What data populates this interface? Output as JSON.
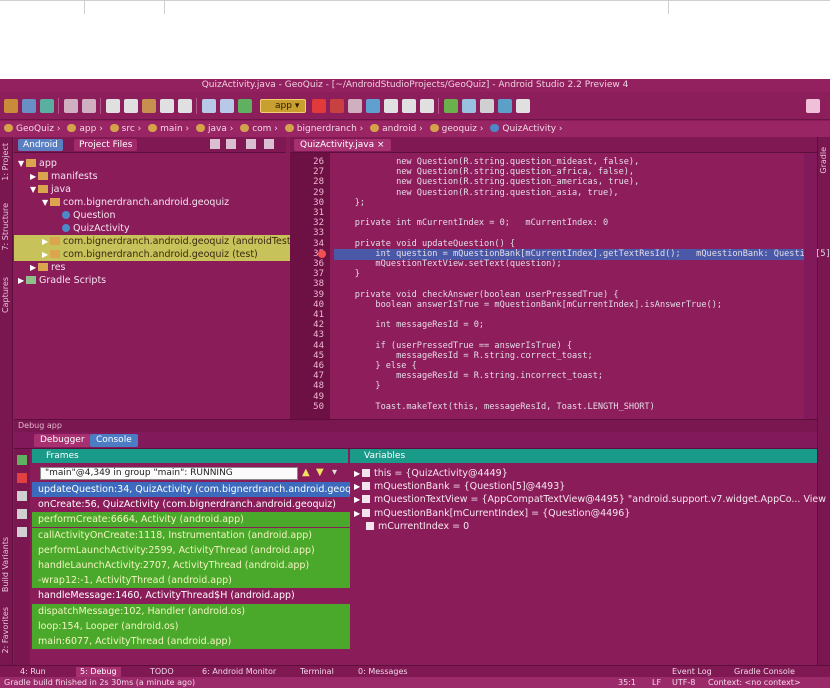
{
  "window": {
    "title": "QuizActivity.java - GeoQuiz - [~/AndroidStudioProjects/GeoQuiz] - Android Studio 2.2 Preview 4"
  },
  "toolbar": {
    "run_config": "app",
    "icons": [
      "open-icon",
      "save-icon",
      "sync-icon",
      "undo-icon",
      "redo-icon",
      "cut-icon",
      "copy-icon",
      "paste-icon",
      "find-icon",
      "replace-icon",
      "back-icon",
      "forward-icon",
      "build-icon",
      "run-config-dropdown",
      "run-icon",
      "debug-icon",
      "profile-icon",
      "avd-icon",
      "sdk-icon",
      "help-icon",
      "search-icon"
    ]
  },
  "breadcrumbs": [
    "GeoQuiz",
    "app",
    "src",
    "main",
    "java",
    "com",
    "bignerdranch",
    "android",
    "geoquiz",
    "QuizActivity"
  ],
  "left_strip": {
    "project": "1: Project",
    "structure": "7: Structure",
    "captures": "Captures",
    "variants": "Build Variants",
    "favorites": "2: Favorites"
  },
  "right_strip": {
    "gradle": "Gradle"
  },
  "project_pane": {
    "tabs": [
      "Android",
      "Project Files"
    ],
    "tree": [
      {
        "label": "app",
        "depth": 0,
        "expanded": true,
        "icon": "folder"
      },
      {
        "label": "manifests",
        "depth": 1,
        "expanded": false,
        "icon": "folder"
      },
      {
        "label": "java",
        "depth": 1,
        "expanded": true,
        "icon": "folder"
      },
      {
        "label": "com.bignerdranch.android.geoquiz",
        "depth": 2,
        "expanded": true,
        "icon": "package"
      },
      {
        "label": "Question",
        "depth": 3,
        "icon": "class"
      },
      {
        "label": "QuizActivity",
        "depth": 3,
        "icon": "class"
      },
      {
        "label": "com.bignerdranch.android.geoquiz (androidTest)",
        "depth": 2,
        "expanded": false,
        "icon": "package",
        "selected": true
      },
      {
        "label": "com.bignerdranch.android.geoquiz (test)",
        "depth": 2,
        "expanded": false,
        "icon": "package",
        "selected": true
      },
      {
        "label": "res",
        "depth": 1,
        "expanded": false,
        "icon": "folder"
      },
      {
        "label": "Gradle Scripts",
        "depth": 0,
        "expanded": false,
        "icon": "gradle"
      }
    ]
  },
  "editor": {
    "tab": "QuizActivity.java",
    "lines": [
      {
        "n": 26,
        "text": "            new Question(R.string.question_mideast, false),"
      },
      {
        "n": 27,
        "text": "            new Question(R.string.question_africa, false),"
      },
      {
        "n": 28,
        "text": "            new Question(R.string.question_americas, true),"
      },
      {
        "n": 29,
        "text": "            new Question(R.string.question_asia, true),"
      },
      {
        "n": 30,
        "text": "    };"
      },
      {
        "n": 31,
        "text": ""
      },
      {
        "n": 32,
        "text": "    private int mCurrentIndex = 0;   mCurrentIndex: 0"
      },
      {
        "n": 33,
        "text": ""
      },
      {
        "n": 34,
        "text": "    private void updateQuestion() {"
      },
      {
        "n": 35,
        "text": "        int question = mQuestionBank[mCurrentIndex].getTextResId();   mQuestionBank: Question[5]"
      },
      {
        "n": 36,
        "text": "        mQuestionTextView.setText(question);"
      },
      {
        "n": 37,
        "text": "    }"
      },
      {
        "n": 38,
        "text": ""
      },
      {
        "n": 39,
        "text": "    private void checkAnswer(boolean userPressedTrue) {"
      },
      {
        "n": 40,
        "text": "        boolean answerIsTrue = mQuestionBank[mCurrentIndex].isAnswerTrue();"
      },
      {
        "n": 41,
        "text": ""
      },
      {
        "n": 42,
        "text": "        int messageResId = 0;"
      },
      {
        "n": 43,
        "text": ""
      },
      {
        "n": 44,
        "text": "        if (userPressedTrue == answerIsTrue) {"
      },
      {
        "n": 45,
        "text": "            messageResId = R.string.correct_toast;"
      },
      {
        "n": 46,
        "text": "        } else {"
      },
      {
        "n": 47,
        "text": "            messageResId = R.string.incorrect_toast;"
      },
      {
        "n": 48,
        "text": "        }"
      },
      {
        "n": 49,
        "text": ""
      },
      {
        "n": 50,
        "text": "        Toast.makeText(this, messageResId, Toast.LENGTH_SHORT)"
      }
    ],
    "current_line": 35
  },
  "debugger": {
    "header": "Debug  app",
    "tabs": [
      "Debugger",
      "Console"
    ],
    "frames_title": "Frames",
    "thread": "\"main\"@4,349 in group \"main\": RUNNING",
    "frames": [
      {
        "text": "updateQuestion:34, QuizActivity (com.bignerdranch.android.geoquiz)",
        "style": "sel"
      },
      {
        "text": "onCreate:56, QuizActivity (com.bignerdranch.android.geoquiz)",
        "style": "plain"
      },
      {
        "text": "performCreate:6664, Activity (android.app)",
        "style": "green"
      },
      {
        "text": "callActivityOnCreate:1118, Instrumentation (android.app)",
        "style": "green"
      },
      {
        "text": "performLaunchActivity:2599, ActivityThread (android.app)",
        "style": "green"
      },
      {
        "text": "handleLaunchActivity:2707, ActivityThread (android.app)",
        "style": "green"
      },
      {
        "text": "-wrap12:-1, ActivityThread (android.app)",
        "style": "green"
      },
      {
        "text": "handleMessage:1460, ActivityThread$H (android.app)",
        "style": "plain"
      },
      {
        "text": "dispatchMessage:102, Handler (android.os)",
        "style": "green"
      },
      {
        "text": "loop:154, Looper (android.os)",
        "style": "green"
      },
      {
        "text": "main:6077, ActivityThread (android.app)",
        "style": "green"
      }
    ],
    "variables_title": "Variables",
    "variables": [
      {
        "text": "this = {QuizActivity@4449}",
        "expandable": true
      },
      {
        "text": "mQuestionBank = {Question[5]@4493}",
        "expandable": true
      },
      {
        "text": "mQuestionTextView = {AppCompatTextView@4495} \"android.support.v7.widget.AppCo... View",
        "expandable": true
      },
      {
        "text": "mQuestionBank[mCurrentIndex] = {Question@4496}",
        "expandable": true
      },
      {
        "text": "mCurrentIndex = 0",
        "expandable": false
      }
    ]
  },
  "bottom_tabs": [
    "4: Run",
    "5: Debug",
    "TODO",
    "6: Android Monitor",
    "Terminal",
    "0: Messages",
    "Event Log",
    "Gradle Console"
  ],
  "status": {
    "message": "Gradle build finished in 2s 30ms (a minute ago)",
    "position": "35:1",
    "line_sep": "LF",
    "encoding": "UTF-8",
    "context": "Context: <no context>"
  },
  "colors": {
    "window_bg": "#8b1c5a",
    "frames_header": "#1a9a88",
    "frame_green": "#4aa82b",
    "frame_selected": "#3c6bbd",
    "tree_selected": "#c7c25a",
    "code_highlight": "#4a58a8"
  }
}
